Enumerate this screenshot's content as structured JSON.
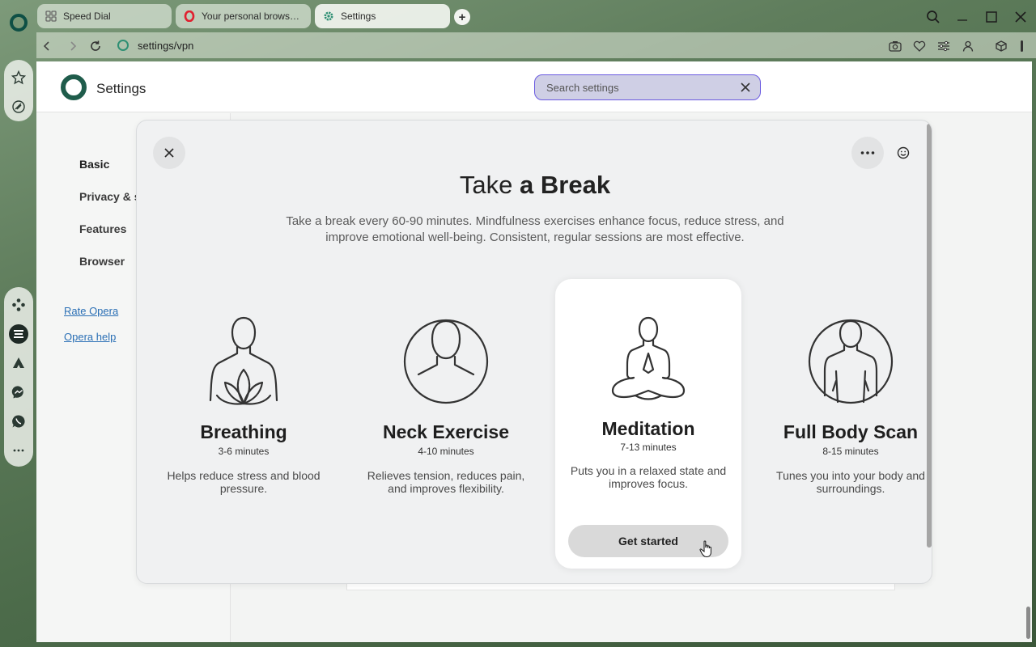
{
  "tabs": [
    {
      "label": "Speed Dial",
      "icon": "grid-icon"
    },
    {
      "label": "Your personal browser is",
      "icon": "opera-icon"
    },
    {
      "label": "Settings",
      "icon": "gear-icon",
      "active": true
    }
  ],
  "address_bar": {
    "url": "settings/vpn"
  },
  "header": {
    "title": "Settings",
    "search_placeholder": "Search settings"
  },
  "nav": {
    "items": [
      {
        "label": "Basic"
      },
      {
        "label": "Privacy & s"
      },
      {
        "label": "Features"
      },
      {
        "label": "Browser"
      }
    ],
    "links": [
      {
        "label": "Rate Opera"
      },
      {
        "label": "Opera help"
      }
    ]
  },
  "dialog": {
    "title_light": "Take",
    "title_bold": "a Break",
    "subtitle": "Take a break every 60-90 minutes. Mindfulness exercises enhance focus, reduce stress, and improve emotional well-being. Consistent, regular sessions are most effective.",
    "exercises": [
      {
        "name": "Breathing",
        "duration": "3-6 minutes",
        "description": "Helps reduce stress and blood pressure.",
        "icon": "lotus-person-icon"
      },
      {
        "name": "Neck Exercise",
        "duration": "4-10 minutes",
        "description": "Relieves tension, reduces pain, and improves flexibility.",
        "icon": "person-circle-icon"
      },
      {
        "name": "Meditation",
        "duration": "7-13 minutes",
        "description": "Puts you in a relaxed state and improves focus.",
        "icon": "meditating-person-icon",
        "cta": "Get started"
      },
      {
        "name": "Full Body Scan",
        "duration": "8-15 minutes",
        "description": "Tunes you into your body and surroundings.",
        "icon": "body-scan-icon"
      }
    ]
  },
  "colors": {
    "accent": "#6a5ae0",
    "opera_green": "#1f5c4b",
    "link": "#2a6fb5",
    "dialog_bg": "#f0f1f2"
  }
}
